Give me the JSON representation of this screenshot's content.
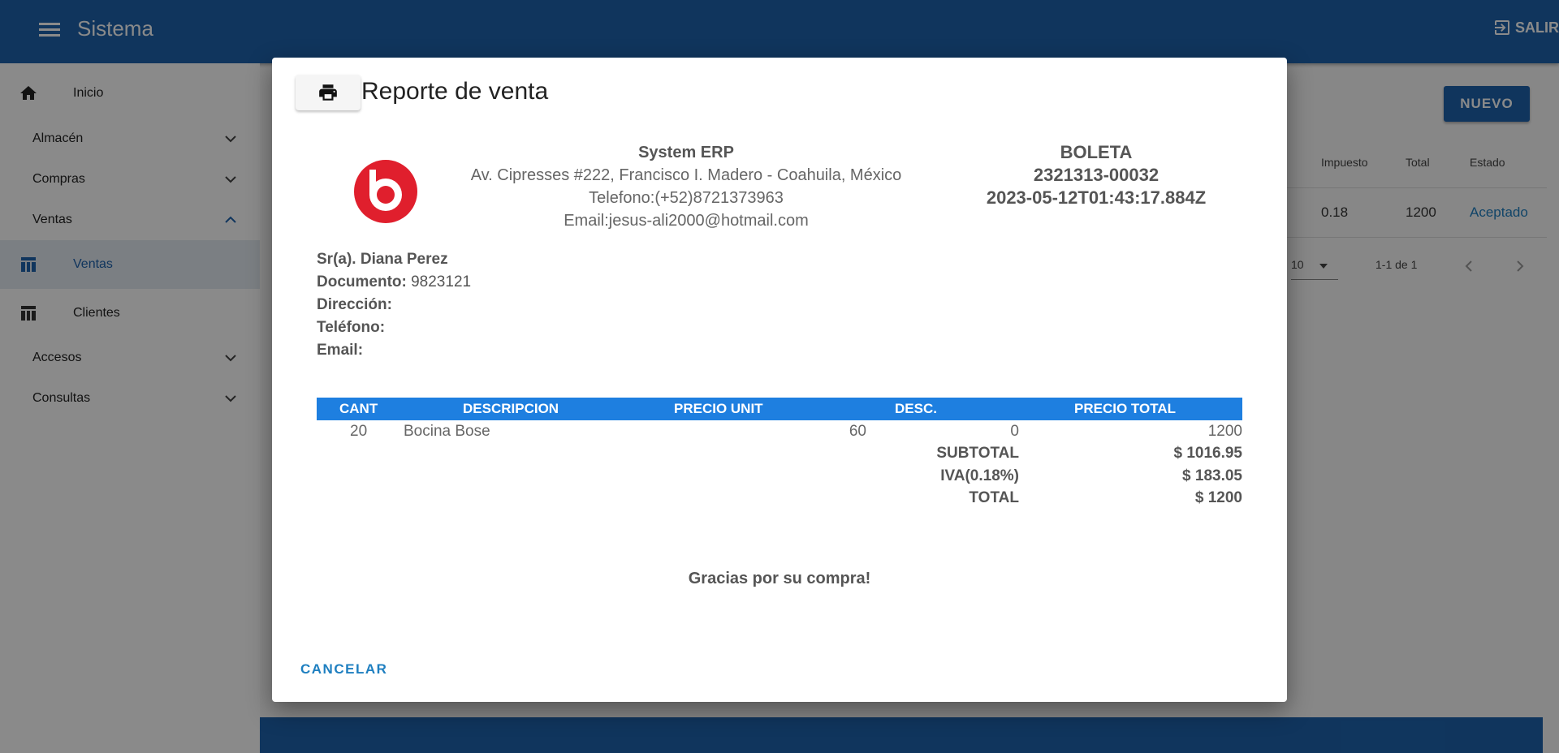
{
  "appbar": {
    "title": "Sistema",
    "logout_label": "SALIR"
  },
  "sidebar": {
    "items": [
      {
        "label": "Inicio"
      },
      {
        "label": "Almacén"
      },
      {
        "label": "Compras"
      },
      {
        "label": "Ventas"
      },
      {
        "label": "Ventas"
      },
      {
        "label": "Clientes"
      },
      {
        "label": "Accesos"
      },
      {
        "label": "Consultas"
      }
    ]
  },
  "main": {
    "new_button": "NUEVO",
    "table": {
      "headers": [
        "Impuesto",
        "Total",
        "Estado"
      ],
      "row": [
        "0.18",
        "1200",
        "Aceptado"
      ]
    },
    "pager": {
      "rows_per_page": "10",
      "range": "1-1 de 1"
    },
    "colors": {
      "primary": "#1e63ad",
      "accent": "#1e7fe0",
      "link": "#1e7fc0"
    }
  },
  "dialog": {
    "title": "Reporte de venta",
    "company": {
      "name": "System ERP",
      "address": "Av. Cipresses #222, Francisco I. Madero - Coahuila, México",
      "phone": "Telefono:(+52)8721373963",
      "email": "Email:jesus-ali2000@hotmail.com"
    },
    "voucher": {
      "type": "BOLETA",
      "number": "2321313-00032",
      "date": "2023-05-12T01:43:17.884Z"
    },
    "client": {
      "name": "Sr(a). Diana Perez",
      "doc_label": "Documento:",
      "doc_value": "9823121",
      "address_label": "Dirección:",
      "phone_label": "Teléfono:",
      "email_label": "Email:"
    },
    "items_headers": [
      "CANT",
      "DESCRIPCION",
      "PRECIO UNIT",
      "DESC.",
      "PRECIO TOTAL"
    ],
    "items": [
      {
        "qty": "20",
        "description": "Bocina Bose",
        "unit_price": "60",
        "discount": "0",
        "total": "1200"
      }
    ],
    "summary": {
      "subtotal_label": "SUBTOTAL",
      "subtotal": "$ 1016.95",
      "tax_label": "IVA(0.18%)",
      "tax": "$ 183.05",
      "total_label": "TOTAL",
      "total": "$ 1200"
    },
    "thanks": "Gracias por su compra!",
    "cancel_label": "CANCELAR"
  }
}
